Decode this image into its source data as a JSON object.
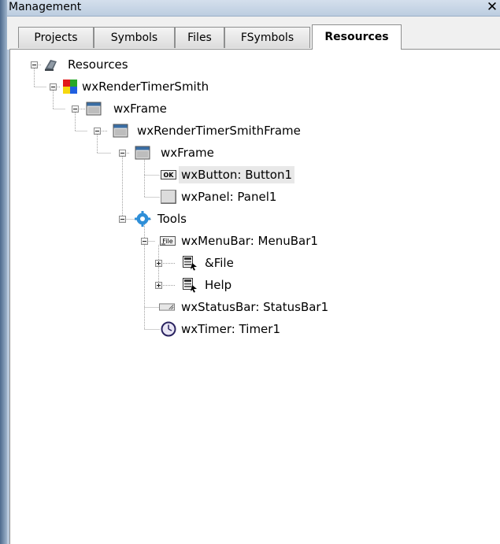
{
  "window": {
    "title": "Management",
    "close_glyph": "✕"
  },
  "tabs": [
    {
      "label": "Projects",
      "active": false
    },
    {
      "label": "Symbols",
      "active": false
    },
    {
      "label": "Files",
      "active": false
    },
    {
      "label": "FSymbols",
      "active": false
    },
    {
      "label": "Resources",
      "active": true
    }
  ],
  "tree": [
    {
      "label": "Resources",
      "icon": "resources-icon",
      "expanded": true,
      "depth": 0
    },
    {
      "label": "wxRenderTimerSmith",
      "icon": "multicolor-project-icon",
      "expanded": true,
      "depth": 1
    },
    {
      "label": "wxFrame",
      "icon": "frame-window-icon",
      "expanded": true,
      "depth": 2
    },
    {
      "label": "wxRenderTimerSmithFrame",
      "icon": "frame-window-icon",
      "expanded": true,
      "depth": 3
    },
    {
      "label": "wxFrame",
      "icon": "frame-window-icon",
      "expanded": true,
      "depth": 4
    },
    {
      "label": "wxButton: Button1",
      "icon": "ok-button-icon",
      "depth": 5,
      "selected": true
    },
    {
      "label": "wxPanel: Panel1",
      "icon": "panel-icon",
      "depth": 5
    },
    {
      "label": "Tools",
      "icon": "tools-gear-icon",
      "expanded": true,
      "depth": 4
    },
    {
      "label": "wxMenuBar: MenuBar1",
      "icon": "file-menu-icon",
      "expanded": true,
      "depth": 5
    },
    {
      "label": "&File",
      "icon": "menu-item-icon",
      "expanded": false,
      "depth": 6
    },
    {
      "label": "Help",
      "icon": "menu-item-icon",
      "expanded": false,
      "depth": 6
    },
    {
      "label": "wxStatusBar: StatusBar1",
      "icon": "status-bar-icon",
      "depth": 5
    },
    {
      "label": "wxTimer: Timer1",
      "icon": "clock-icon",
      "depth": 5
    }
  ],
  "colors": {
    "selection": "#e8e8e8",
    "tree_line": "#a0a0a0",
    "active_tab": "#ffffff"
  }
}
